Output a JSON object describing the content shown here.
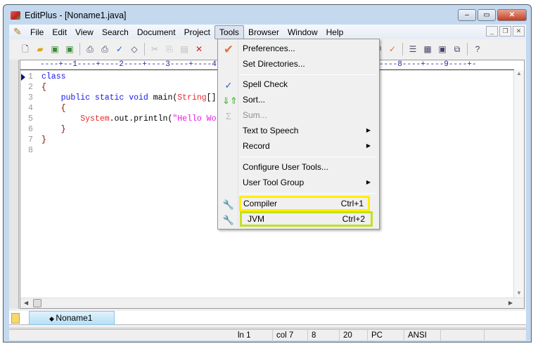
{
  "window": {
    "title": "EditPlus - [Noname1.java]",
    "minimize": "‒",
    "maximize": "▭",
    "close": "✕"
  },
  "menubar": [
    "File",
    "Edit",
    "View",
    "Search",
    "Document",
    "Project",
    "Tools",
    "Browser",
    "Window",
    "Help"
  ],
  "ruler": "----+--1----+----2----+----3----+----4----+----5----+----6----+----7----+----8----+----9----+-",
  "code": {
    "line_numbers": [
      "1",
      "2",
      "3",
      "4",
      "5",
      "6",
      "7",
      "8"
    ],
    "l1": "class",
    "l2": "{",
    "l3_indent": "    ",
    "l3_a": "public static void ",
    "l3_b": "main(",
    "l3_c": "String",
    "l3_d": "[]",
    "l4": "    {",
    "l5_indent": "        ",
    "l5_a": "System",
    "l5_b": ".out.println(",
    "l5_c": "\"Hello Wo",
    "l6": "    }",
    "l7": "}"
  },
  "tab": {
    "label": "Noname1"
  },
  "status": {
    "line": "ln 1",
    "col": "col 7",
    "c3": "8",
    "c4": "20",
    "mode": "PC",
    "encoding": "ANSI"
  },
  "tools_menu": {
    "items": [
      {
        "label": "Preferences..."
      },
      {
        "label": "Set Directories..."
      },
      {
        "label": "Spell Check"
      },
      {
        "label": "Sort..."
      },
      {
        "label": "Sum..."
      },
      {
        "label": "Text to Speech"
      },
      {
        "label": "Record"
      },
      {
        "label": "Configure User Tools..."
      },
      {
        "label": "User Tool Group"
      },
      {
        "label": "Compiler",
        "shortcut": "Ctrl+1"
      },
      {
        "label": "JVM",
        "shortcut": "Ctrl+2"
      }
    ]
  },
  "colors": {
    "highlight_compiler": "#ffee00",
    "highlight_jvm": "#c4e020"
  }
}
